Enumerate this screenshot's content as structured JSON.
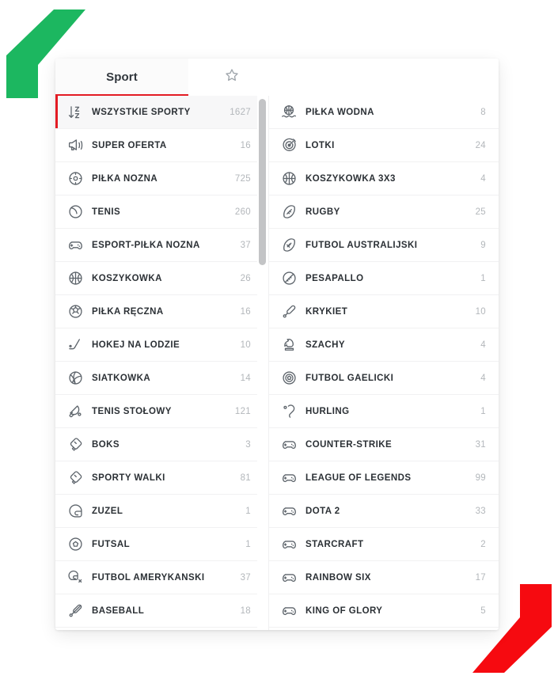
{
  "theme": {
    "accent_red": "#e31b23",
    "accent_green": "#1cb760",
    "text_dark": "#2b3035",
    "text_muted": "#b3b7bb",
    "icon_gray": "#5d646b",
    "card_bg": "#ffffff",
    "row_selected_bg": "#f7f7f8"
  },
  "tabs": [
    {
      "id": "sport",
      "label": "Sport",
      "icon": "",
      "active": true
    },
    {
      "id": "favourites",
      "label": "",
      "icon": "star-icon",
      "active": false
    }
  ],
  "columns": {
    "left": {
      "scrollbar": {
        "visible": true
      },
      "items": [
        {
          "icon": "sort-az-icon",
          "label": "WSZYSTKIE SPORTY",
          "count": "1627",
          "selected": true
        },
        {
          "icon": "megaphone-icon",
          "label": "SUPER OFERTA",
          "count": "16",
          "selected": false
        },
        {
          "icon": "soccer-ball-icon",
          "label": "PIŁKA NOŻNA",
          "count": "725",
          "selected": false
        },
        {
          "icon": "tennis-ball-icon",
          "label": "TENIS",
          "count": "260",
          "selected": false
        },
        {
          "icon": "gamepad-icon",
          "label": "ESPORT-PIŁKA NOŻNA",
          "count": "37",
          "selected": false
        },
        {
          "icon": "basketball-icon",
          "label": "KOSZYKÓWKA",
          "count": "26",
          "selected": false
        },
        {
          "icon": "handball-icon",
          "label": "PIŁKA RĘCZNA",
          "count": "16",
          "selected": false
        },
        {
          "icon": "ice-hockey-icon",
          "label": "HOKEJ NA LODZIE",
          "count": "10",
          "selected": false
        },
        {
          "icon": "volleyball-icon",
          "label": "SIATKÓWKA",
          "count": "14",
          "selected": false
        },
        {
          "icon": "table-tennis-icon",
          "label": "TENIS STOŁOWY",
          "count": "121",
          "selected": false
        },
        {
          "icon": "boxing-glove-icon",
          "label": "BOKS",
          "count": "3",
          "selected": false
        },
        {
          "icon": "boxing-glove-icon",
          "label": "SPORTY WALKI",
          "count": "81",
          "selected": false
        },
        {
          "icon": "helmet-icon",
          "label": "ŻUŻEL",
          "count": "1",
          "selected": false
        },
        {
          "icon": "futsal-icon",
          "label": "FUTSAL",
          "count": "1",
          "selected": false
        },
        {
          "icon": "american-football-icon",
          "label": "FUTBOL AMERYKAŃSKI",
          "count": "37",
          "selected": false
        },
        {
          "icon": "baseball-bat-icon",
          "label": "BASEBALL",
          "count": "18",
          "selected": false
        }
      ]
    },
    "right": {
      "scrollbar": {
        "visible": false
      },
      "items": [
        {
          "icon": "water-polo-icon",
          "label": "PIŁKA WODNA",
          "count": "8",
          "selected": false
        },
        {
          "icon": "darts-icon",
          "label": "LOTKI",
          "count": "24",
          "selected": false
        },
        {
          "icon": "basketball-icon",
          "label": "KOSZYKÓWKA 3X3",
          "count": "4",
          "selected": false
        },
        {
          "icon": "rugby-ball-icon",
          "label": "RUGBY",
          "count": "25",
          "selected": false
        },
        {
          "icon": "aussie-rules-icon",
          "label": "FUTBOL AUSTRALIJSKI",
          "count": "9",
          "selected": false
        },
        {
          "icon": "pesapallo-icon",
          "label": "PESAPALLO",
          "count": "1",
          "selected": false
        },
        {
          "icon": "cricket-icon",
          "label": "KRYKIET",
          "count": "10",
          "selected": false
        },
        {
          "icon": "chess-knight-icon",
          "label": "SZACHY",
          "count": "4",
          "selected": false
        },
        {
          "icon": "gaelic-football-icon",
          "label": "FUTBOL GAELICKI",
          "count": "4",
          "selected": false
        },
        {
          "icon": "hurling-icon",
          "label": "HURLING",
          "count": "1",
          "selected": false
        },
        {
          "icon": "gamepad-icon",
          "label": "COUNTER-STRIKE",
          "count": "31",
          "selected": false
        },
        {
          "icon": "gamepad-icon",
          "label": "LEAGUE OF LEGENDS",
          "count": "99",
          "selected": false
        },
        {
          "icon": "gamepad-icon",
          "label": "DOTA 2",
          "count": "33",
          "selected": false
        },
        {
          "icon": "gamepad-icon",
          "label": "STARCRAFT",
          "count": "2",
          "selected": false
        },
        {
          "icon": "gamepad-icon",
          "label": "RAINBOW SIX",
          "count": "17",
          "selected": false
        },
        {
          "icon": "gamepad-icon",
          "label": "KING OF GLORY",
          "count": "5",
          "selected": false
        }
      ]
    }
  },
  "decorations": [
    {
      "name": "green-chevron-shape",
      "color": "#1cb760"
    },
    {
      "name": "red-chevron-shape",
      "color": "#f60a10"
    }
  ]
}
